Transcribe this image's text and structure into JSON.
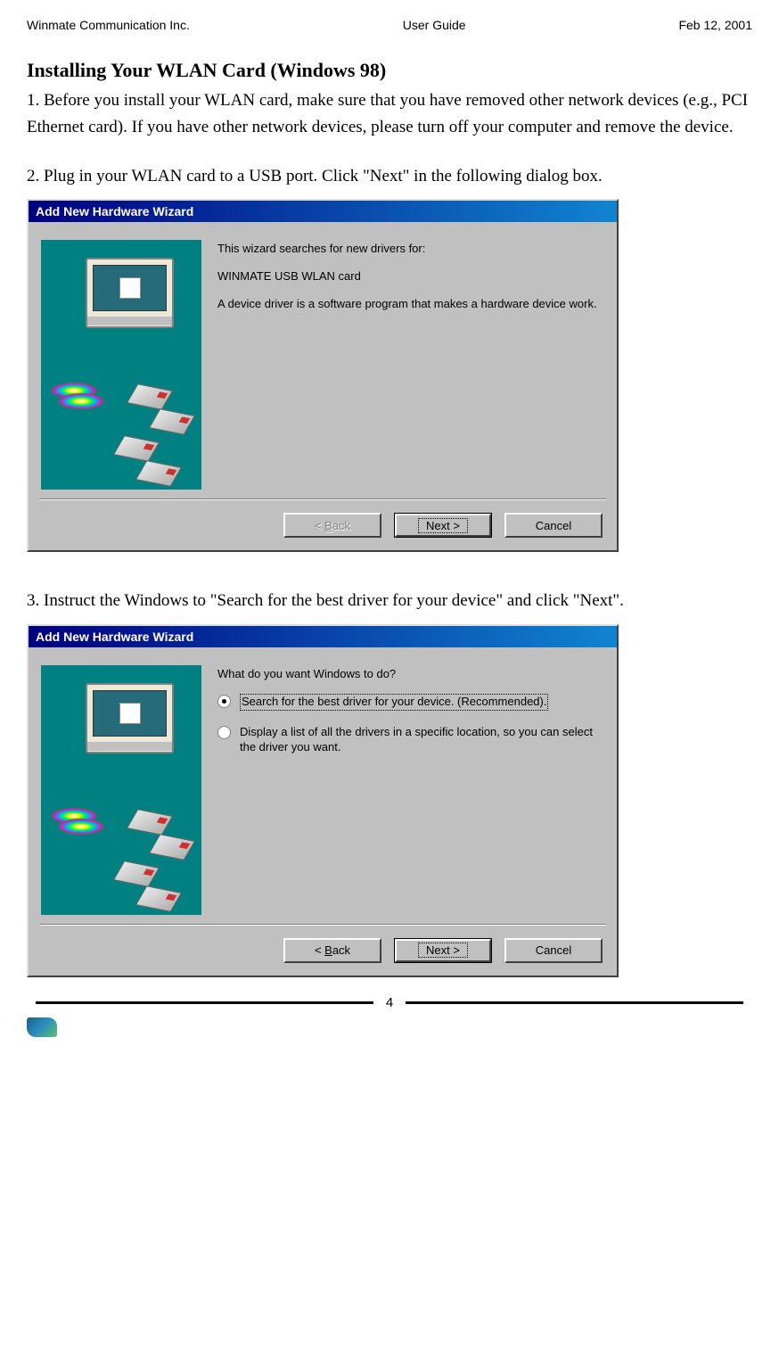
{
  "header": {
    "left": "Winmate Communication Inc.",
    "center": "User Guide",
    "right": "Feb 12, 2001"
  },
  "section_title": "Installing Your WLAN Card (Windows 98)",
  "step1": "1. Before you install your WLAN card, make sure that you have removed other network devices (e.g., PCI Ethernet card). If you have other network devices, please turn off your computer and remove the device.",
  "step2": "2. Plug in your WLAN card to a USB port. Click \"Next\" in the following dialog box.",
  "step3": "3. Instruct the Windows to \"Search for the best driver for your device\" and click \"Next\".",
  "dialog1": {
    "title": "Add New Hardware Wizard",
    "line1": "This wizard searches for new drivers for:",
    "device": "WINMATE USB WLAN card",
    "line2": "A device driver is a software program that makes a hardware device work.",
    "back": "< Back",
    "next": "Next >",
    "cancel": "Cancel"
  },
  "dialog2": {
    "title": "Add New Hardware Wizard",
    "prompt": "What do you want Windows to do?",
    "option1": "Search for the best driver for your device. (Recommended).",
    "option2": "Display a list of all the drivers in a specific location, so you can select the driver you want.",
    "back": "< Back",
    "next": "Next >",
    "cancel": "Cancel"
  },
  "page_number": "4"
}
